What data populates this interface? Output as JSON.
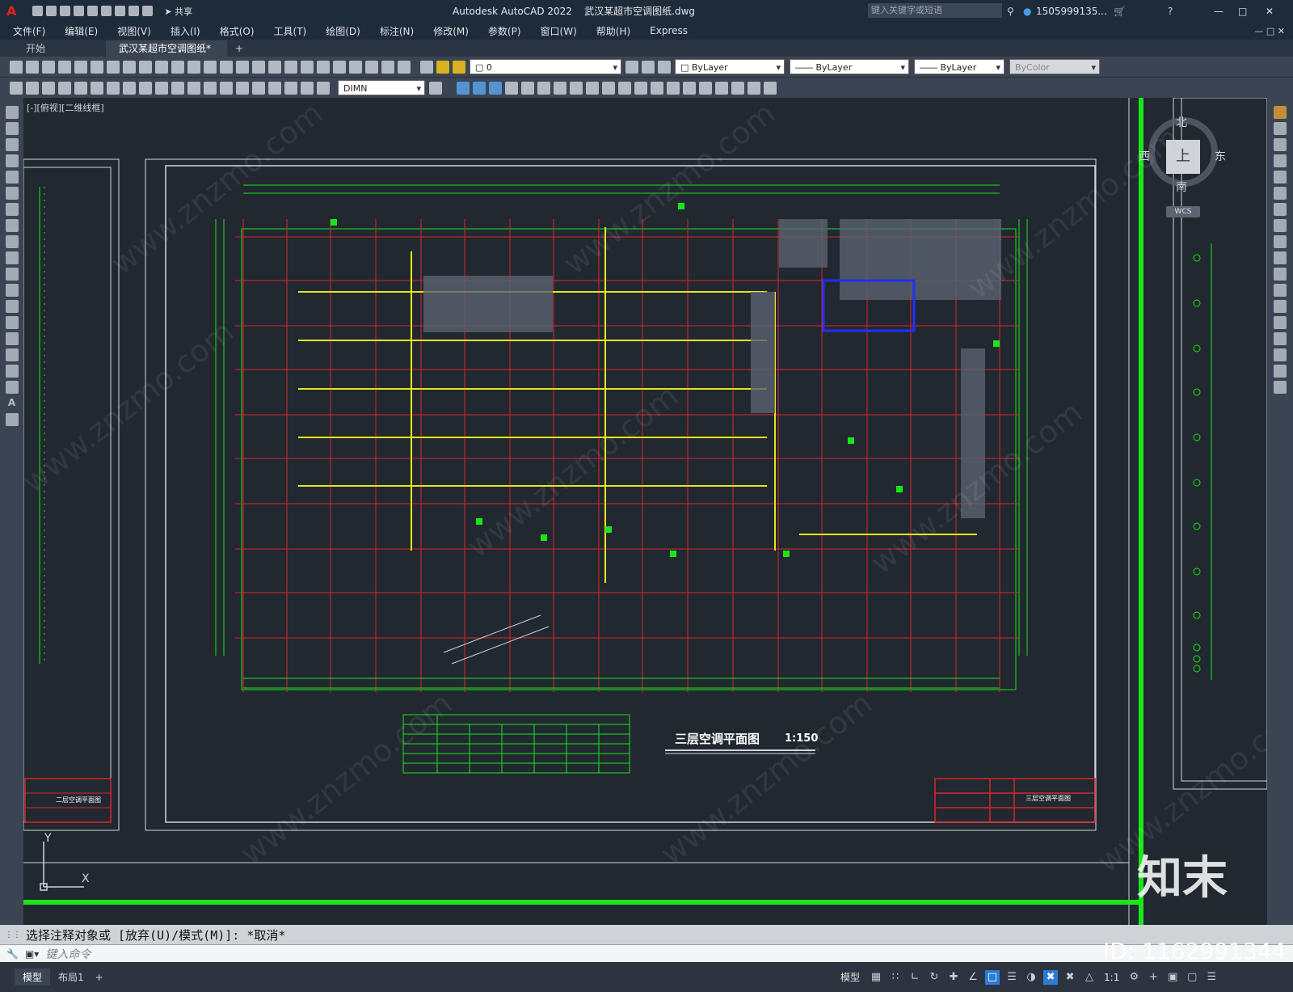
{
  "app": {
    "title": "Autodesk AutoCAD 2022    武汉某超市空调图纸.dwg",
    "search_placeholder": "键入关键字或短语",
    "user": "1505999135...",
    "share_label": "共享"
  },
  "menu": [
    "文件(F)",
    "编辑(E)",
    "视图(V)",
    "插入(I)",
    "格式(O)",
    "工具(T)",
    "绘图(D)",
    "标注(N)",
    "修改(M)",
    "参数(P)",
    "窗口(W)",
    "帮助(H)",
    "Express"
  ],
  "tabs": [
    {
      "label": "开始"
    },
    {
      "label": "武汉某超市空调图纸*"
    }
  ],
  "toolbar": {
    "layer_value": "0",
    "color_value": "ByLayer",
    "linetype_value": "ByLayer",
    "lineweight_value": "ByLayer",
    "plotstyle_value": "ByColor",
    "dimstyle_value": "DIMN"
  },
  "viewport": {
    "label": "[-][俯视][二维线框]"
  },
  "viewcube": {
    "north": "北",
    "south": "南",
    "east": "东",
    "west": "西",
    "top": "上",
    "wcs": "WCS"
  },
  "drawing": {
    "title": "三层空调平面图",
    "scale": "1:150",
    "left_sheet_title": "二层空调平面图",
    "right_sheet_title": "三层空调平面图",
    "ucs_x": "X",
    "ucs_y": "Y"
  },
  "command": {
    "history": "选择注释对象或 [放弃(U)/模式(M)]: *取消*",
    "placeholder": "键入命令"
  },
  "status": {
    "layout_tabs": [
      "模型",
      "布局1"
    ],
    "model_label": "模型",
    "scale": "1:1"
  },
  "watermark": {
    "site": "www.znzmo.com",
    "logo": "知末",
    "id": "ID: 1162991344"
  },
  "colors": {
    "accent_green": "#19e619",
    "grid_red": "#d9262b",
    "selected_blue": "#2030ff",
    "background": "#212830"
  }
}
